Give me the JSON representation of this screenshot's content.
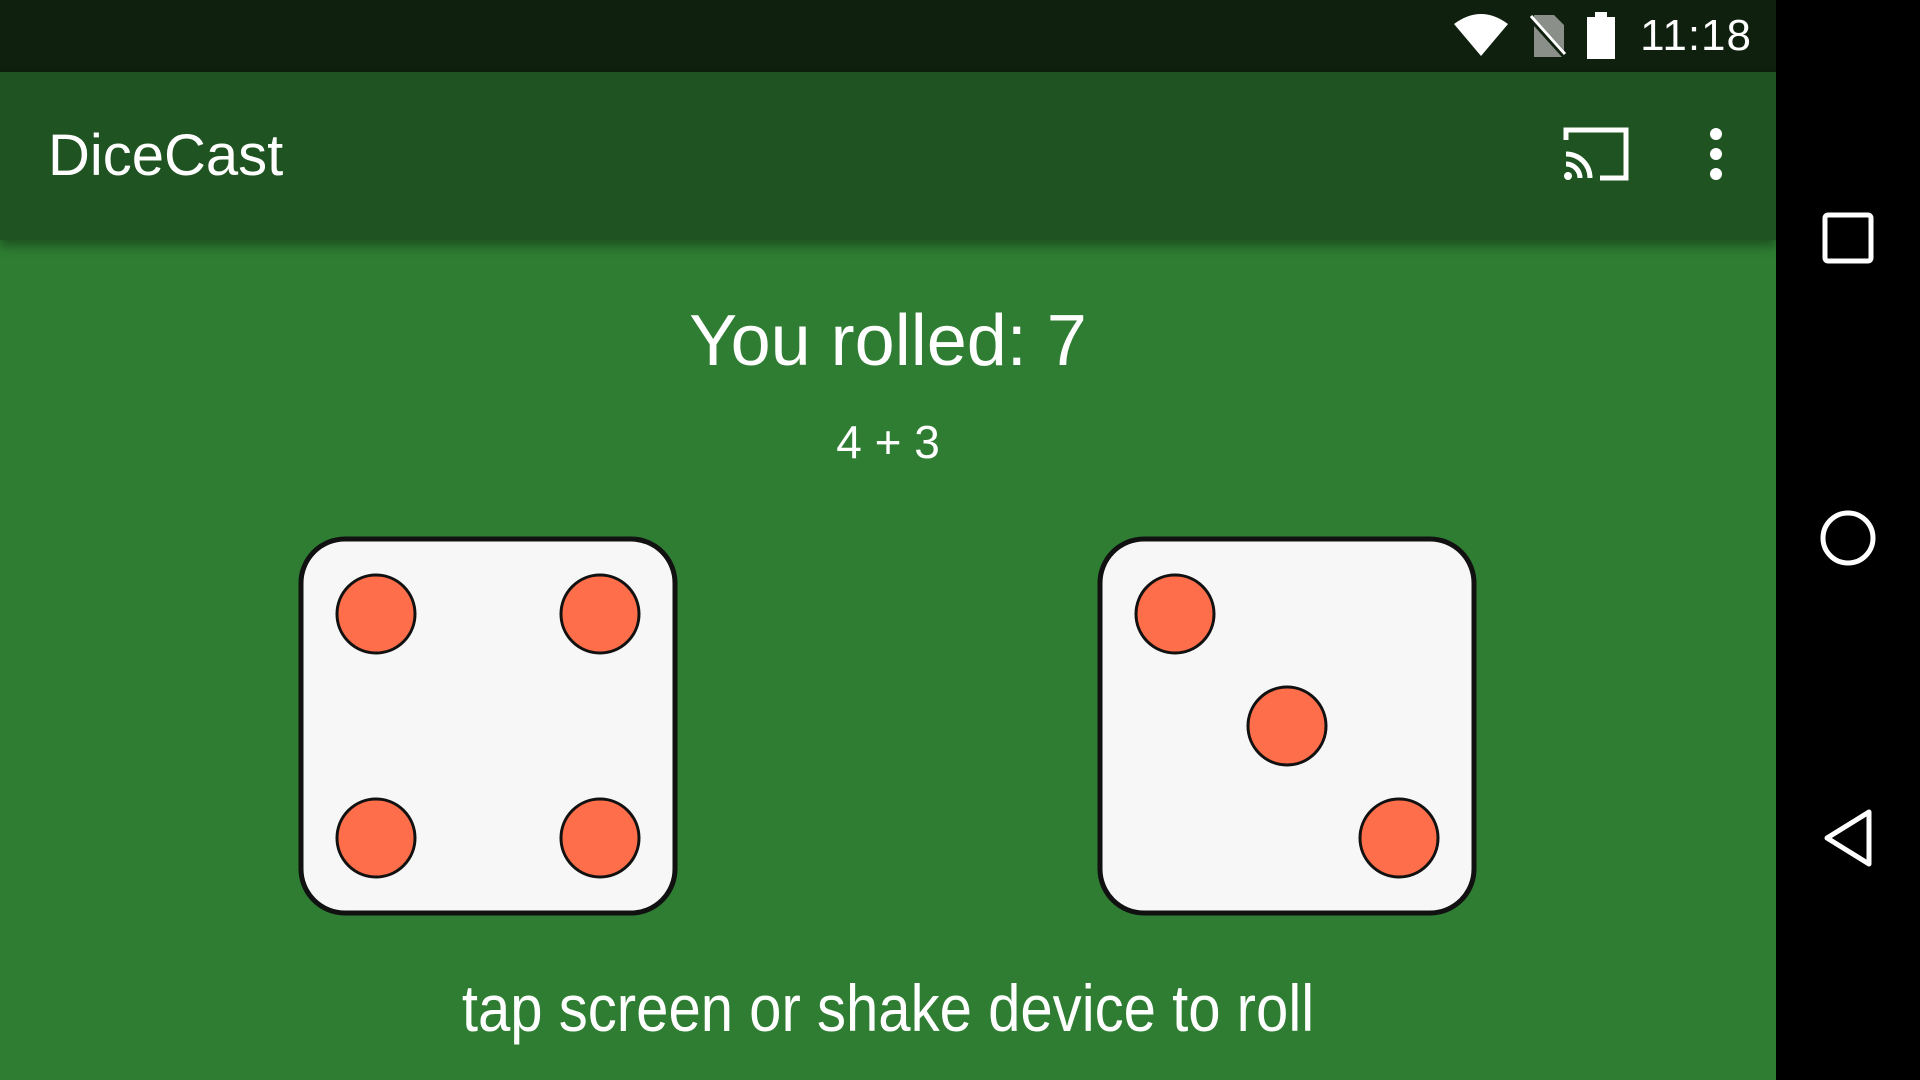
{
  "status_bar": {
    "time": "11:18",
    "icons": [
      "wifi-icon",
      "no-sim-icon",
      "battery-icon"
    ]
  },
  "app_bar": {
    "title": "DiceCast",
    "actions": [
      "cast-icon",
      "overflow-menu-icon"
    ]
  },
  "main": {
    "result_title": "You rolled: 7",
    "result_breakdown": "4 + 3",
    "dice": [
      {
        "value": 4
      },
      {
        "value": 3
      }
    ],
    "hint": "tap screen or shake device to roll"
  },
  "nav_bar": {
    "buttons": [
      "recents-icon",
      "home-icon",
      "back-icon"
    ]
  },
  "colors": {
    "background": "#2e7d32",
    "app_bar": "#1f5322",
    "status_bar": "#0f200f",
    "die_face": "#f7f7f7",
    "pip": "#ff6e4a",
    "outline": "#111111"
  }
}
